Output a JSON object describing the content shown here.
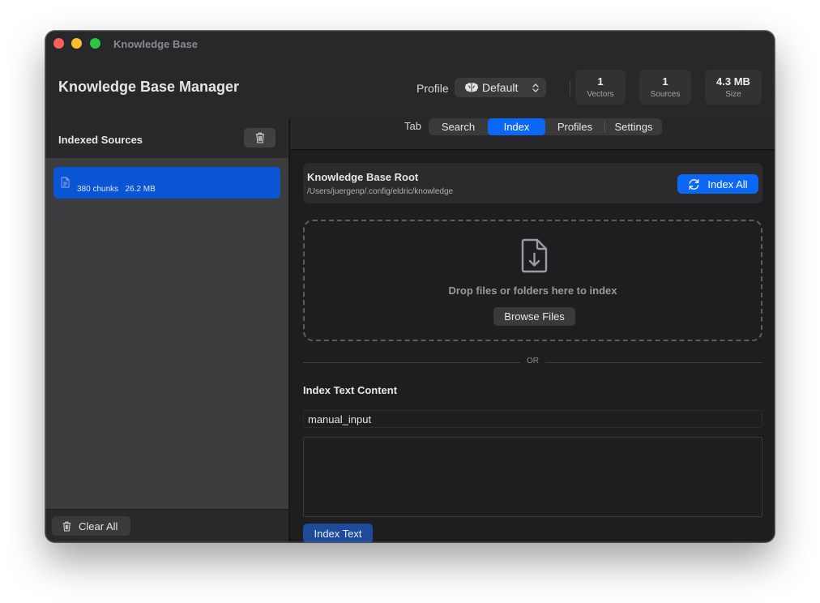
{
  "window": {
    "title": "Knowledge Base"
  },
  "header": {
    "app_title": "Knowledge Base Manager",
    "profile_label": "Profile",
    "profile_value": "Default",
    "stats": [
      {
        "value": "1",
        "label": "Vectors"
      },
      {
        "value": "1",
        "label": "Sources"
      },
      {
        "value": "4.3 MB",
        "label": "Size"
      }
    ]
  },
  "sidebar": {
    "title": "Indexed Sources",
    "items": [
      {
        "chunks": "380 chunks",
        "size": "26.2 MB",
        "selected": true
      }
    ],
    "clear_all_label": "Clear All"
  },
  "tabs": {
    "label": "Tab",
    "items": [
      "Search",
      "Index",
      "Profiles",
      "Settings"
    ],
    "active": "Index"
  },
  "index_panel": {
    "root_title": "Knowledge Base Root",
    "root_path": "/Users/juergenp/.config/eldric/knowledge",
    "index_all_label": "Index All",
    "drop_text": "Drop files or folders here to index",
    "browse_label": "Browse Files",
    "or_label": "OR",
    "text_heading": "Index Text Content",
    "source_name_value": "manual_input",
    "text_content_value": "",
    "index_text_label": "Index Text"
  },
  "colors": {
    "accent": "#0a68f5",
    "selection": "#0a55d4",
    "index_text_button": "#1e4a99",
    "traffic_red": "#fe5f57",
    "traffic_yellow": "#febc2e",
    "traffic_green": "#28c840"
  },
  "icons": [
    "brain-icon",
    "chevron-updown-icon",
    "trash-icon",
    "document-icon",
    "refresh-icon",
    "document-download-icon"
  ]
}
